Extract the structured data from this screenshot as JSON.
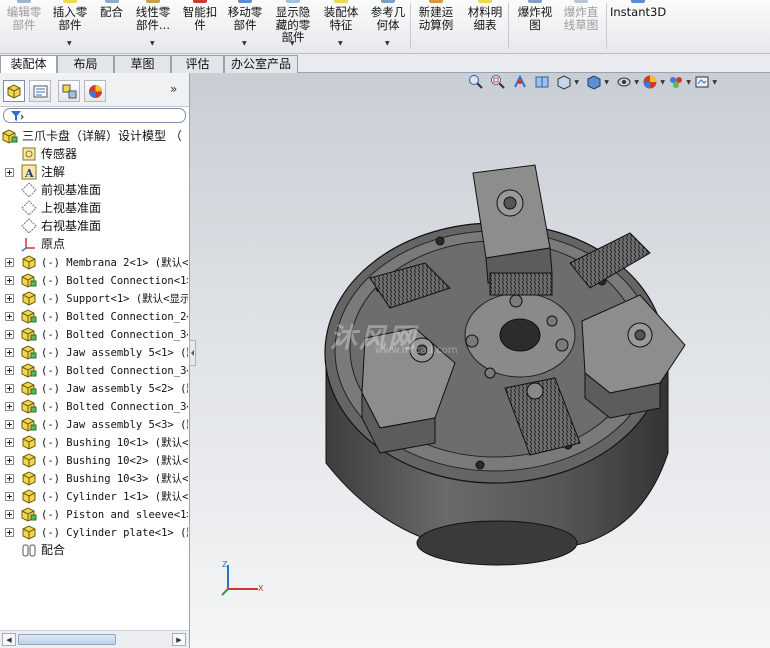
{
  "ribbon": {
    "items": [
      {
        "label": "编辑零\n部件",
        "disabled": true
      },
      {
        "label": "插入零\n部件"
      },
      {
        "label": "配合"
      },
      {
        "label": "线性零\n部件..."
      },
      {
        "label": "智能扣\n件"
      },
      {
        "label": "移动零\n部件"
      },
      {
        "label": "显示隐\n藏的零\n部件"
      },
      {
        "label": "装配体\n特征"
      },
      {
        "label": "参考几\n何体"
      },
      {
        "label": "新建运\n动算例"
      },
      {
        "label": "材料明\n细表"
      },
      {
        "label": "爆炸视\n图"
      },
      {
        "label": "爆炸直\n线草图",
        "disabled": true
      },
      {
        "label": "Instant3D"
      }
    ]
  },
  "tabs": [
    "装配体",
    "布局",
    "草图",
    "评估",
    "办公室产品"
  ],
  "feature_tree": {
    "root": "三爪卡盘（详解）设计模型  （",
    "nodes": [
      {
        "label": "传感器",
        "icon": "sensor-icon",
        "expandable": false,
        "mono": false
      },
      {
        "label": "注解",
        "icon": "annotation-icon",
        "expandable": true,
        "mono": false
      },
      {
        "label": "前视基准面",
        "icon": "plane-icon",
        "expandable": false,
        "mono": false
      },
      {
        "label": "上视基准面",
        "icon": "plane-icon",
        "expandable": false,
        "mono": false
      },
      {
        "label": "右视基准面",
        "icon": "plane-icon",
        "expandable": false,
        "mono": false
      },
      {
        "label": "原点",
        "icon": "origin-icon",
        "expandable": false,
        "mono": false
      },
      {
        "label": "(-) Membrana 2<1> (默认<",
        "icon": "part-icon",
        "expandable": true,
        "mono": true
      },
      {
        "label": "(-) Bolted Connection<1>",
        "icon": "subassembly-icon",
        "expandable": true,
        "mono": true
      },
      {
        "label": "(-) Support<1> (默认<显示",
        "icon": "part-icon",
        "expandable": true,
        "mono": true
      },
      {
        "label": "(-) Bolted Connection_2<",
        "icon": "subassembly-icon",
        "expandable": true,
        "mono": true
      },
      {
        "label": "(-) Bolted Connection_3<",
        "icon": "subassembly-icon",
        "expandable": true,
        "mono": true
      },
      {
        "label": "(-) Jaw assembly 5<1> (默",
        "icon": "subassembly-icon",
        "expandable": true,
        "mono": true
      },
      {
        "label": "(-) Bolted Connection_3<",
        "icon": "subassembly-icon",
        "expandable": true,
        "mono": true
      },
      {
        "label": "(-) Jaw assembly 5<2> (默",
        "icon": "subassembly-icon",
        "expandable": true,
        "mono": true
      },
      {
        "label": "(-) Bolted Connection_3<",
        "icon": "subassembly-icon",
        "expandable": true,
        "mono": true
      },
      {
        "label": "(-) Jaw assembly 5<3> (默",
        "icon": "subassembly-icon",
        "expandable": true,
        "mono": true
      },
      {
        "label": "(-) Bushing 10<1> (默认<",
        "icon": "part-icon",
        "expandable": true,
        "mono": true
      },
      {
        "label": "(-) Bushing 10<2> (默认<",
        "icon": "part-icon",
        "expandable": true,
        "mono": true
      },
      {
        "label": "(-) Bushing 10<3> (默认<",
        "icon": "part-icon",
        "expandable": true,
        "mono": true
      },
      {
        "label": "(-) Cylinder 1<1> (默认<",
        "icon": "part-icon",
        "expandable": true,
        "mono": true
      },
      {
        "label": "(-) Piston and sleeve<1>",
        "icon": "subassembly-icon",
        "expandable": true,
        "mono": true
      },
      {
        "label": "(-) Cylinder plate<1> (默",
        "icon": "part-icon",
        "expandable": true,
        "mono": true
      },
      {
        "label": "配合",
        "icon": "mates-icon",
        "expandable": false,
        "mono": false
      }
    ]
  },
  "watermark": {
    "text": "沐风网",
    "url": "www.mfcad.com"
  },
  "colors": {
    "accent": "#2f6fc7",
    "viewport_top": "#c9ced5",
    "viewport_bottom": "#f4f5f6",
    "model": "#5a5a5a"
  }
}
